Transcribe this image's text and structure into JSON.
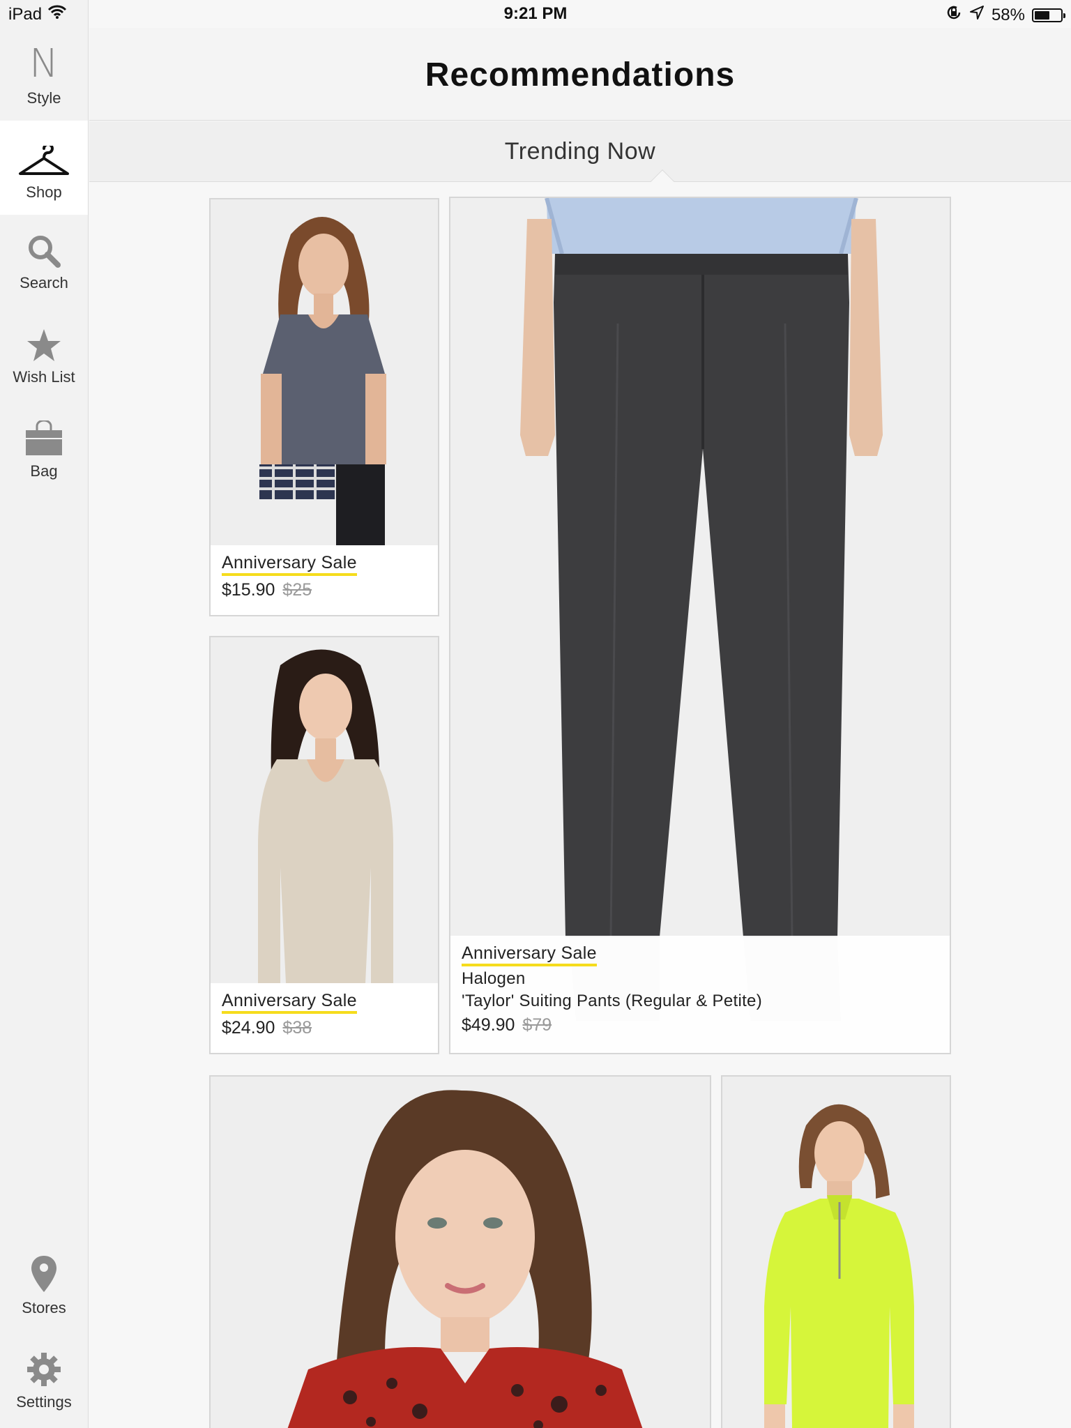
{
  "status_bar": {
    "device": "iPad",
    "time": "9:21 PM",
    "battery_percent": "58%",
    "battery_level": 0.58,
    "icons": [
      "wifi-icon",
      "rotation-lock-icon",
      "location-arrow-icon",
      "battery-icon"
    ]
  },
  "sidebar": {
    "items": [
      {
        "label": "Style",
        "icon": "nordstrom-n-icon"
      },
      {
        "label": "Shop",
        "icon": "hanger-icon",
        "active": true
      },
      {
        "label": "Search",
        "icon": "search-icon"
      },
      {
        "label": "Wish List",
        "icon": "star-icon"
      },
      {
        "label": "Bag",
        "icon": "bag-icon"
      },
      {
        "label": "Stores",
        "icon": "map-pin-icon"
      },
      {
        "label": "Settings",
        "icon": "gear-icon"
      }
    ]
  },
  "header": {
    "title": "Recommendations"
  },
  "section": {
    "title": "Trending Now"
  },
  "products": [
    {
      "sale_label": "Anniversary Sale",
      "price": "$15.90",
      "old_price": "$25"
    },
    {
      "sale_label": "Anniversary Sale",
      "price": "$24.90",
      "old_price": "$38"
    },
    {
      "sale_label": "Anniversary Sale",
      "brand": "Halogen",
      "name": "'Taylor' Suiting Pants (Regular & Petite)",
      "price": "$49.90",
      "old_price": "$79"
    },
    {},
    {}
  ],
  "colors": {
    "sale_underline": "#f5dc1c",
    "sidebar_bg": "#f2f2f2",
    "active_bg": "#ffffff"
  }
}
